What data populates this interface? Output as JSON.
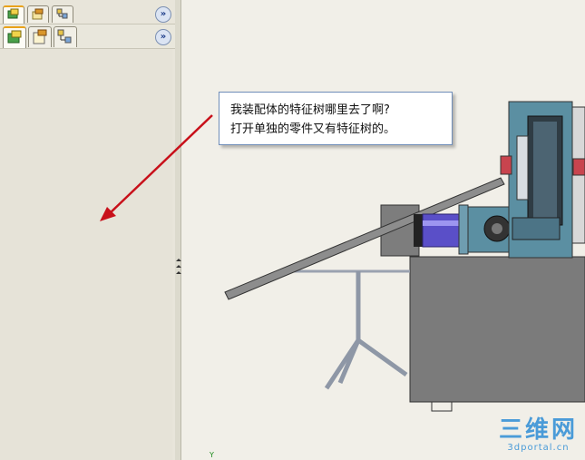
{
  "panel": {
    "top_tabs": [
      {
        "name": "feature-manager-tab",
        "active": true
      },
      {
        "name": "property-manager-tab",
        "active": false
      },
      {
        "name": "configuration-manager-tab",
        "active": false
      }
    ],
    "second_tabs": [
      {
        "name": "feature-manager-tab",
        "active": true
      },
      {
        "name": "property-manager-tab",
        "active": false
      },
      {
        "name": "configuration-manager-tab",
        "active": false
      }
    ],
    "expand_glyph": "»"
  },
  "callout": {
    "line1": "我装配体的特征树哪里去了啊?",
    "line2": "打开单独的零件又有特征树的。"
  },
  "viewport": {
    "axis_label": "Y"
  },
  "watermark": {
    "brand": "三维网",
    "url": "3dportal.cn"
  },
  "colors": {
    "arrow": "#c8101a",
    "accent_tab": "#e9a21a",
    "machine_blue": "#5b8fa2",
    "motor_purple": "#5a4fc8",
    "table_gray": "#7b7b7b",
    "watermark": "#4a9bd8"
  }
}
